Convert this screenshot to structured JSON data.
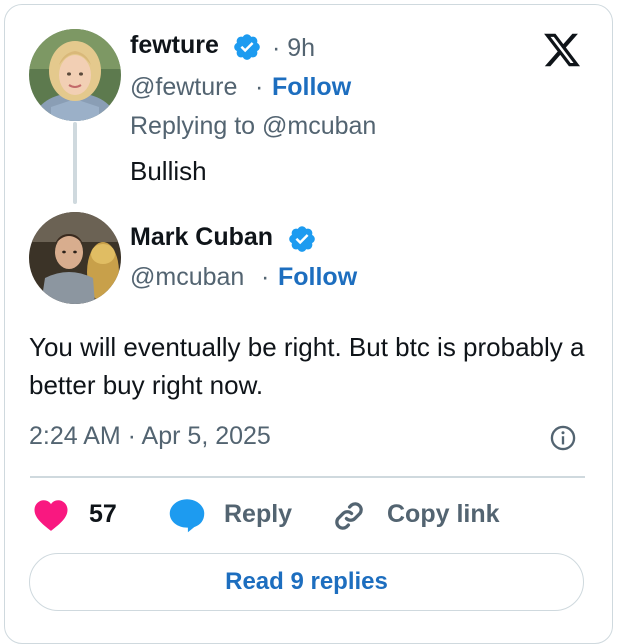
{
  "reply_to_tweet": {
    "display_name": "fewture",
    "separator_time": "· 9h",
    "handle": "@fewture",
    "separator_follow": "·",
    "follow_label": "Follow",
    "replying_to": "Replying to @mcuban",
    "text": "Bullish"
  },
  "main_tweet": {
    "display_name": "Mark Cuban",
    "handle": "@mcuban",
    "separator_follow": "·",
    "follow_label": "Follow",
    "text": "You will eventually be right. But btc is probably a better buy right now.",
    "timestamp": "2:24 AM · Apr 5, 2025"
  },
  "actions": {
    "like_count": "57",
    "reply_label": "Reply",
    "copy_link_label": "Copy link"
  },
  "read_replies_label": "Read 9 replies",
  "colors": {
    "like": "#f91880",
    "reply": "#1d9bf0",
    "link": "#1d6ebf",
    "verified": "#1d9bf0",
    "border": "#cfd9de"
  },
  "icons": [
    "x-logo-icon",
    "verified-badge-icon",
    "heart-icon",
    "reply-bubble-icon",
    "link-icon",
    "info-icon"
  ]
}
